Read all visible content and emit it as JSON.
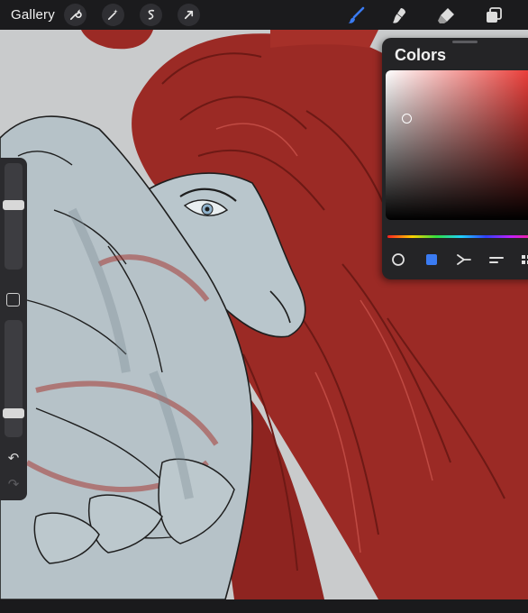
{
  "toolbar": {
    "gallery_label": "Gallery",
    "left_tools": [
      "wrench-icon",
      "magic-wand-icon",
      "selection-icon",
      "transform-arrow-icon"
    ],
    "right_tools": [
      "brush-icon",
      "smudge-icon",
      "eraser-icon",
      "layers-icon"
    ],
    "active_tool": "brush-icon",
    "active_color": "#3a7bf2"
  },
  "sidebar": {
    "brush_size": 0.62,
    "brush_opacity": 0.18
  },
  "colors_panel": {
    "title": "Colors",
    "current_color": "#f0d6d4",
    "hue_color": "#e8302b",
    "modes": [
      "disc-icon",
      "classic-icon",
      "harmony-icon",
      "value-icon",
      "palettes-icon"
    ],
    "active_mode": "classic-icon"
  },
  "canvas": {
    "background": "#c9cbcc",
    "hair_color": "#9b2a25",
    "skin_color": "#b9c6cc"
  }
}
